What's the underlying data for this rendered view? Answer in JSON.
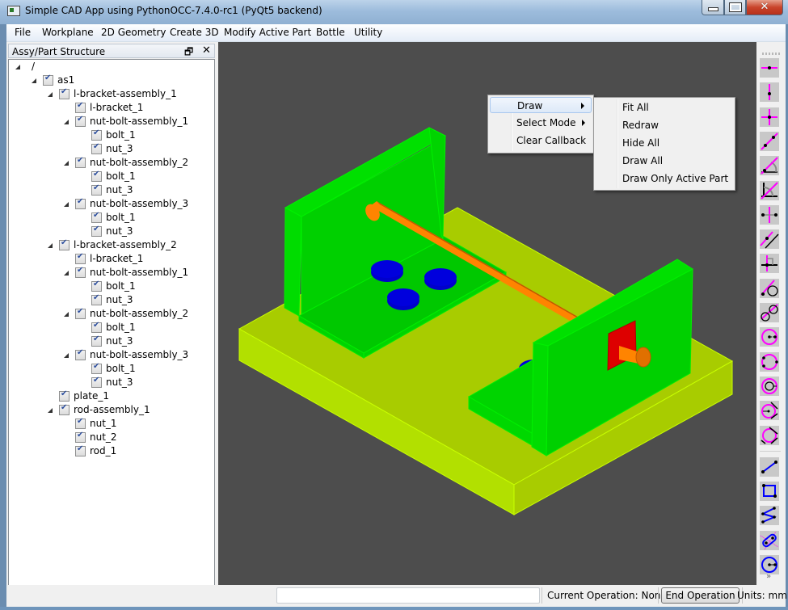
{
  "window": {
    "title": "Simple CAD App using PythonOCC-7.4.0-rc1 (PyQt5 backend)",
    "minimize_glyph": "",
    "maximize_glyph": "",
    "close_glyph": "✕"
  },
  "menubar": {
    "items": [
      "File",
      "Workplane",
      "2D Geometry",
      "Create 3D",
      "Modify Active Part",
      "Bottle",
      "Utility"
    ]
  },
  "dock": {
    "title": "Assy/Part Structure",
    "float_glyph": "🗗",
    "close_glyph": "✕"
  },
  "tree": {
    "items": [
      {
        "label": "/",
        "depth": 0,
        "expanded": true,
        "checkbox": false
      },
      {
        "label": "as1",
        "depth": 1,
        "expanded": true,
        "checked": true
      },
      {
        "label": "l-bracket-assembly_1",
        "depth": 2,
        "expanded": true,
        "checked": true
      },
      {
        "label": "l-bracket_1",
        "depth": 3,
        "checked": true
      },
      {
        "label": "nut-bolt-assembly_1",
        "depth": 3,
        "expanded": true,
        "checked": true
      },
      {
        "label": "bolt_1",
        "depth": 4,
        "checked": true
      },
      {
        "label": "nut_3",
        "depth": 4,
        "checked": true
      },
      {
        "label": "nut-bolt-assembly_2",
        "depth": 3,
        "expanded": true,
        "checked": true
      },
      {
        "label": "bolt_1",
        "depth": 4,
        "checked": true
      },
      {
        "label": "nut_3",
        "depth": 4,
        "checked": true
      },
      {
        "label": "nut-bolt-assembly_3",
        "depth": 3,
        "expanded": true,
        "checked": true
      },
      {
        "label": "bolt_1",
        "depth": 4,
        "checked": true
      },
      {
        "label": "nut_3",
        "depth": 4,
        "checked": true
      },
      {
        "label": "l-bracket-assembly_2",
        "depth": 2,
        "expanded": true,
        "checked": true
      },
      {
        "label": "l-bracket_1",
        "depth": 3,
        "checked": true
      },
      {
        "label": "nut-bolt-assembly_1",
        "depth": 3,
        "expanded": true,
        "checked": true
      },
      {
        "label": "bolt_1",
        "depth": 4,
        "checked": true
      },
      {
        "label": "nut_3",
        "depth": 4,
        "checked": true
      },
      {
        "label": "nut-bolt-assembly_2",
        "depth": 3,
        "expanded": true,
        "checked": true
      },
      {
        "label": "bolt_1",
        "depth": 4,
        "checked": true
      },
      {
        "label": "nut_3",
        "depth": 4,
        "checked": true
      },
      {
        "label": "nut-bolt-assembly_3",
        "depth": 3,
        "expanded": true,
        "checked": true
      },
      {
        "label": "bolt_1",
        "depth": 4,
        "checked": true
      },
      {
        "label": "nut_3",
        "depth": 4,
        "checked": true
      },
      {
        "label": "plate_1",
        "depth": 2,
        "checked": true
      },
      {
        "label": "rod-assembly_1",
        "depth": 2,
        "expanded": true,
        "checked": true
      },
      {
        "label": "nut_1",
        "depth": 3,
        "checked": true
      },
      {
        "label": "nut_2",
        "depth": 3,
        "checked": true
      },
      {
        "label": "rod_1",
        "depth": 3,
        "checked": true
      }
    ]
  },
  "viewport": {
    "background": "#4d4d4d",
    "colors": {
      "plate": "#a8cc00",
      "plate_side": "#b2e000",
      "bracket": "#00d400",
      "bracket_edge": "#00f000",
      "rod": "#ff8000",
      "nut_rod": "#e00000",
      "bolt": "#0000dd"
    }
  },
  "context_menu": {
    "items": [
      {
        "label": "Draw",
        "has_submenu": true,
        "highlighted": true
      },
      {
        "label": "Select Mode",
        "has_submenu": true
      },
      {
        "label": "Clear Callback",
        "has_submenu": false
      }
    ]
  },
  "submenu": {
    "items": [
      "Fit All",
      "Redraw",
      "Hide All",
      "Draw All",
      "Draw Only Active Part"
    ]
  },
  "toolbar": {
    "tools": [
      {
        "icon": "horizontal-construction-line-icon"
      },
      {
        "icon": "vertical-construction-line-icon"
      },
      {
        "icon": "horiz-vert-construction-line-icon"
      },
      {
        "icon": "line-two-points-icon"
      },
      {
        "icon": "line-angle-icon"
      },
      {
        "icon": "angle-bisector-icon"
      },
      {
        "icon": "line-between-points-icon"
      },
      {
        "icon": "parallel-line-icon"
      },
      {
        "icon": "perpendicular-line-icon"
      },
      {
        "icon": "line-tangent-circle-icon"
      },
      {
        "icon": "line-tangent-two-circles-icon"
      },
      {
        "icon": "circle-center-radius-icon"
      },
      {
        "icon": "circle-three-points-icon"
      },
      {
        "icon": "concentric-circle-icon"
      },
      {
        "icon": "circle-tangent-icon"
      },
      {
        "icon": "circle-tangent-two-lines-icon"
      },
      {
        "icon": "draw-line-icon"
      },
      {
        "icon": "draw-rectangle-icon"
      },
      {
        "icon": "draw-polyline-icon"
      },
      {
        "icon": "draw-slot-icon"
      },
      {
        "icon": "draw-circle-icon"
      }
    ],
    "more_glyph": "»"
  },
  "statusbar": {
    "input_value": "",
    "current_operation": "Current Operation: None",
    "end_operation_label": "End Operation",
    "units": "Units: mm"
  }
}
